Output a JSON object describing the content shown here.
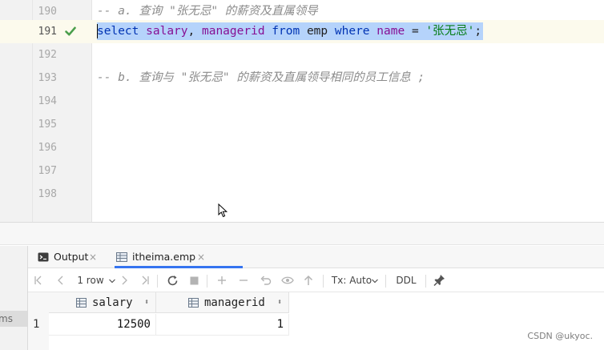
{
  "editor": {
    "lines": [
      {
        "number": "190",
        "text": "-- a. 查询 \"张无忌\" 的薪资及直属领导"
      },
      {
        "number": "191",
        "tokens": {
          "kw1": "select",
          "col1": "salary",
          "comma": ",",
          "col2": "managerid",
          "kw2": "from",
          "table": "emp",
          "kw3": "where",
          "col3": "name",
          "eq": "=",
          "str": "'张无忌'",
          "semi": ";"
        }
      },
      {
        "number": "192",
        "text": ""
      },
      {
        "number": "193",
        "text": "-- b. 查询与 \"张无忌\" 的薪资及直属领导相同的员工信息 ;"
      },
      {
        "number": "194",
        "text": ""
      },
      {
        "number": "195",
        "text": ""
      },
      {
        "number": "196",
        "text": ""
      },
      {
        "number": "197",
        "text": ""
      },
      {
        "number": "198",
        "text": ""
      }
    ],
    "run_status_icon": "check-icon"
  },
  "left_panel": {
    "partial_label": "ms"
  },
  "results": {
    "tabs": [
      {
        "label": "Output",
        "icon": "output-icon",
        "close": "×"
      },
      {
        "label": "itheima.emp",
        "icon": "table-icon",
        "close": "×",
        "active": true
      }
    ],
    "toolbar": {
      "row_count": "1 row",
      "tx_mode": "Tx: Auto",
      "ddl_label": "DDL",
      "icons": [
        "first-page-icon",
        "prev-page-icon",
        "next-page-icon",
        "last-page-icon",
        "refresh-icon",
        "stop-icon",
        "add-row-icon",
        "delete-row-icon",
        "revert-icon",
        "view-icon",
        "submit-icon",
        "pin-icon"
      ]
    },
    "columns": [
      "salary",
      "managerid"
    ],
    "rows": [
      {
        "row_number": "1",
        "salary": "12500",
        "managerid": "1"
      }
    ]
  },
  "watermark": "CSDN @ukyoc."
}
